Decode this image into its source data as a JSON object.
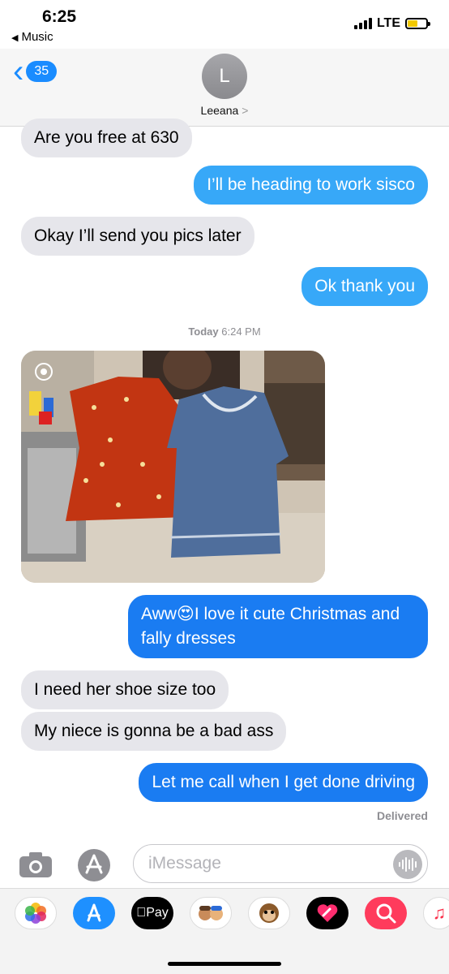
{
  "status_bar": {
    "time": "6:25",
    "back_app": "Music",
    "network": "LTE"
  },
  "header": {
    "unread_count": "35",
    "avatar_initial": "L",
    "contact_name": "Leeana",
    "name_chevron": ">"
  },
  "messages": [
    {
      "direction": "in",
      "text": "Are you free at 630"
    },
    {
      "direction": "out",
      "text": "I’ll be heading to work sisco"
    },
    {
      "direction": "in",
      "text": "Okay I’ll send you pics later"
    },
    {
      "direction": "out",
      "text": "Ok thank you"
    },
    {
      "direction": "out",
      "text_line1": "Aww😍I love it cute Christmas and",
      "text_line2": "fally dresses"
    },
    {
      "direction": "in",
      "text": "I need her shoe size too"
    },
    {
      "direction": "in",
      "text": "My niece is gonna be a bad ass"
    },
    {
      "direction": "out",
      "text": "Let me call when I get done driving"
    }
  ],
  "timestamp": {
    "day": "Today",
    "time": "6:24 PM"
  },
  "delivered_label": "Delivered",
  "composer": {
    "placeholder": "iMessage"
  },
  "drawer": {
    "apps": [
      {
        "name": "photos-app-icon"
      },
      {
        "name": "app-store-icon"
      },
      {
        "name": "apple-pay-icon",
        "label": "Pay"
      },
      {
        "name": "memoji-icon"
      },
      {
        "name": "animoji-monkey-icon"
      },
      {
        "name": "digital-touch-icon"
      },
      {
        "name": "web-images-icon"
      },
      {
        "name": "music-app-icon"
      }
    ]
  },
  "colors": {
    "incoming_bubble": "#e6e6eb",
    "outgoing_bubble": "#37a8f8",
    "outgoing_bubble_dark": "#1a7cf2",
    "accent": "#1a8cff"
  }
}
